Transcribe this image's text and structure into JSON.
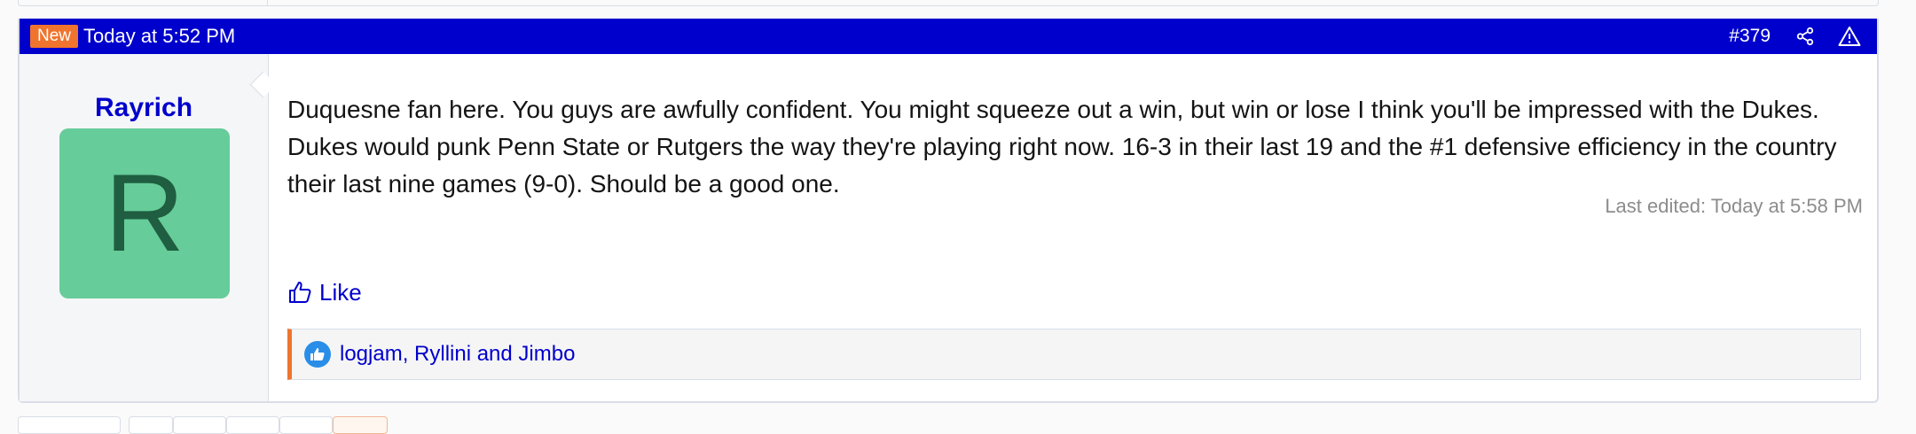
{
  "post": {
    "badge": "New",
    "date": "Today at 5:52 PM",
    "number": "#379",
    "share_icon": "share-icon",
    "report_icon": "warning-icon"
  },
  "user": {
    "name": "Rayrich",
    "avatar_letter": "R",
    "avatar_color": "#66cc99"
  },
  "message": {
    "text": "Duquesne fan here. You guys are awfully confident. You might squeeze out a win, but win or lose I think you'll be impressed with the Dukes. Dukes would punk Penn State or Rutgers the way they're playing right now. 16-3 in their last 19 and the #1 defensive efficiency in the country their last nine games (9-0). Should be a good one.",
    "last_edited": "Last edited: Today at 5:58 PM"
  },
  "actions": {
    "like_label": "Like"
  },
  "reactions": {
    "text": "logjam, Ryllini and Jimbo"
  },
  "colors": {
    "header_bg": "#0000cc",
    "accent": "#f0742d"
  }
}
